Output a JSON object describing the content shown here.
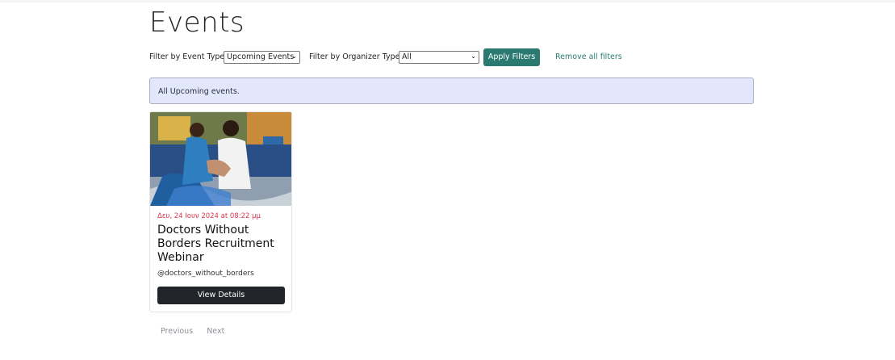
{
  "page": {
    "title": "Events"
  },
  "filters": {
    "event_type_label": "Filter by Event Type:",
    "event_type_value": "Upcoming Events",
    "organizer_type_label": "Filter by Organizer Type:",
    "organizer_type_value": "All",
    "apply_label": "Apply Filters",
    "remove_label": "Remove all filters"
  },
  "alert": {
    "text": "All Upcoming events."
  },
  "events": [
    {
      "date": "Δευ, 24 Ιουν 2024 at 08:22 μμ",
      "title": "Doctors Without Borders Recruitment Webinar",
      "organizer": "@doctors_without_borders",
      "button_label": "View Details"
    }
  ],
  "pagination": {
    "previous": "Previous",
    "next": "Next"
  },
  "colors": {
    "accent": "#2b7a72",
    "date": "#e0344a",
    "alert_bg": "#e2e7fb",
    "dark_button": "#212529"
  }
}
